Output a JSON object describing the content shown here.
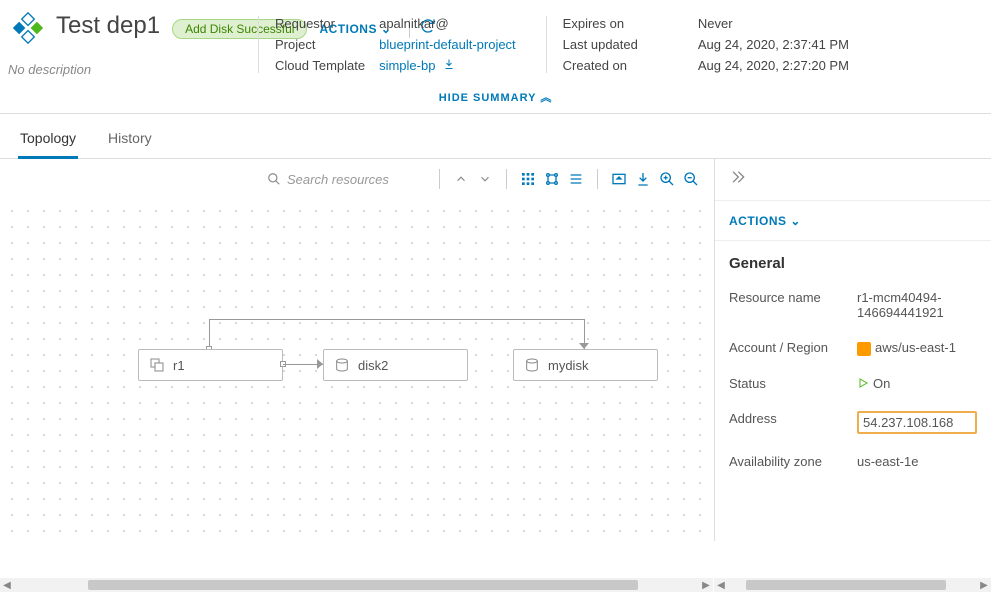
{
  "header": {
    "title": "Test dep1",
    "description": "No description",
    "badge": "Add Disk Successful",
    "actions_label": "ACTIONS"
  },
  "summary": {
    "requestor_label": "Requestor",
    "requestor_value": "apalnitkar@",
    "project_label": "Project",
    "project_value": "blueprint-default-project",
    "template_label": "Cloud Template",
    "template_value": "simple-bp",
    "expires_label": "Expires on",
    "expires_value": "Never",
    "updated_label": "Last updated",
    "updated_value": "Aug 24, 2020, 2:37:41 PM",
    "created_label": "Created on",
    "created_value": "Aug 24, 2020, 2:27:20 PM",
    "hide_label": "HIDE SUMMARY"
  },
  "tabs": {
    "topology": "Topology",
    "history": "History"
  },
  "toolbar": {
    "search_placeholder": "Search resources"
  },
  "nodes": {
    "r1": "r1",
    "disk2": "disk2",
    "mydisk": "mydisk"
  },
  "side": {
    "actions_label": "ACTIONS",
    "section_title": "General",
    "resource_name_label": "Resource name",
    "resource_name_value": "r1-mcm40494-146694441921",
    "account_label": "Account / Region",
    "account_value": "aws/us-east-1",
    "status_label": "Status",
    "status_value": "On",
    "address_label": "Address",
    "address_value": "54.237.108.168",
    "az_label": "Availability zone",
    "az_value": "us-east-1e"
  }
}
